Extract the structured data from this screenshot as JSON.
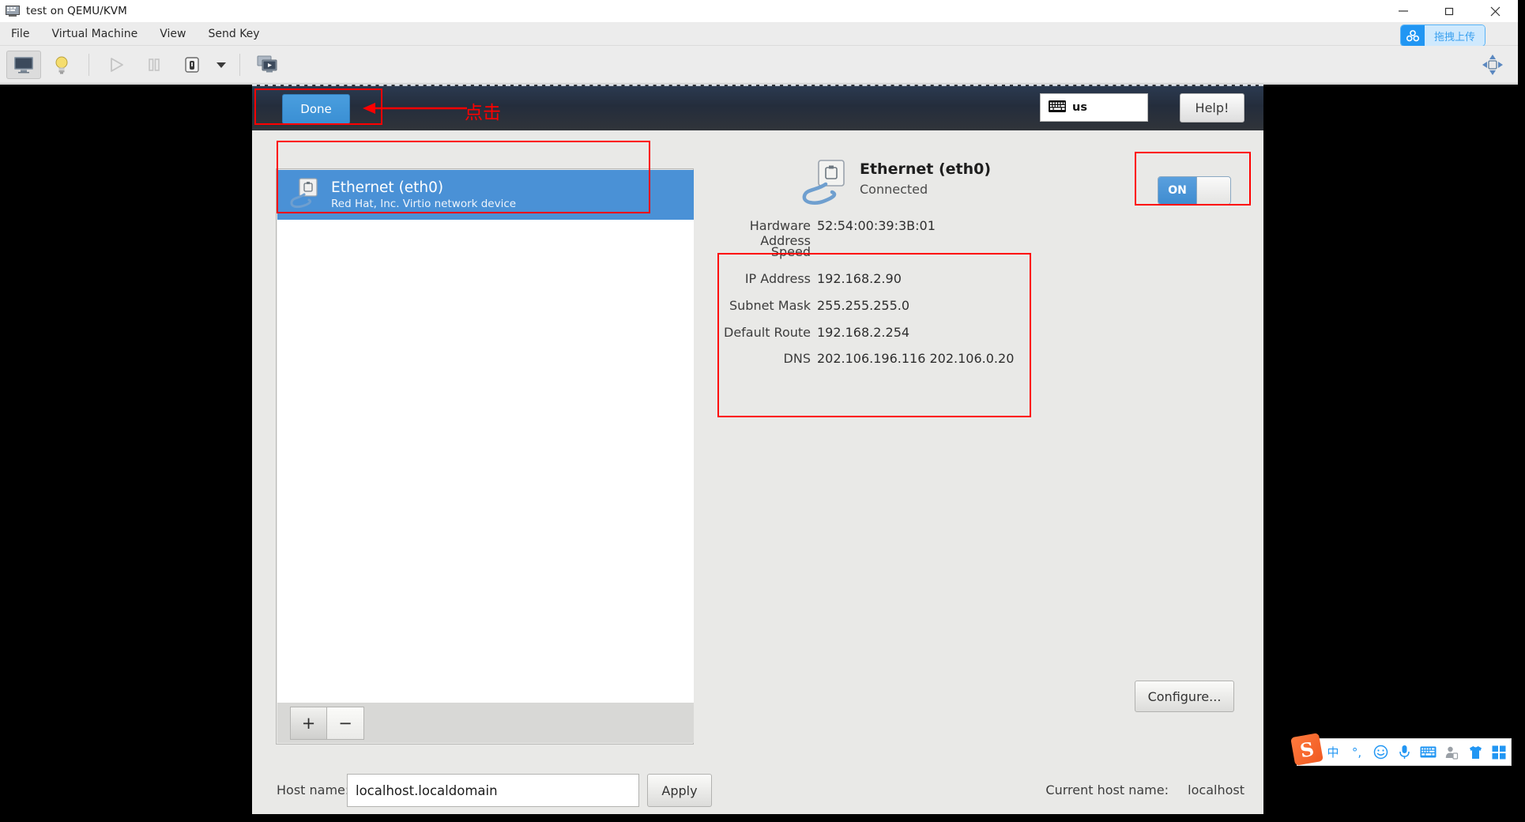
{
  "window": {
    "title": "test on QEMU/KVM",
    "icon": "computer-icon",
    "controls": {
      "minimize": "minimize-icon",
      "maximize": "maximize-icon",
      "close": "close-icon"
    }
  },
  "menubar": {
    "items": [
      {
        "label": "File",
        "name": "menu-file"
      },
      {
        "label": "Virtual Machine",
        "name": "menu-virtual-machine"
      },
      {
        "label": "View",
        "name": "menu-view"
      },
      {
        "label": "Send Key",
        "name": "menu-send-key"
      }
    ],
    "upload_badge": {
      "label": "拖拽上传",
      "icon": "cloud-upload-icon"
    }
  },
  "toolbar": {
    "buttons": [
      {
        "name": "show-console-button",
        "icon": "monitor-icon",
        "active": true
      },
      {
        "name": "show-details-button",
        "icon": "lightbulb-icon",
        "active": false
      },
      {
        "name": "run-button",
        "icon": "play-icon",
        "active": false
      },
      {
        "name": "pause-button",
        "icon": "pause-icon",
        "active": false
      },
      {
        "name": "shutdown-button",
        "icon": "power-icon",
        "active": false
      },
      {
        "name": "shutdown-menu-button",
        "icon": "chevron-down-icon",
        "active": false
      },
      {
        "name": "snapshots-button",
        "icon": "snapshots-icon",
        "active": false
      }
    ],
    "fullscreen": {
      "name": "resize-guest-button",
      "icon": "move-arrows-icon"
    }
  },
  "installer": {
    "header": {
      "done_label": "Done",
      "keyboard_layout": "us",
      "keyboard_icon": "keyboard-icon",
      "help_label": "Help!"
    },
    "device_list": {
      "items": [
        {
          "name": "Ethernet (eth0)",
          "description": "Red Hat, Inc. Virtio network device",
          "icon": "ethernet-icon",
          "selected": true
        }
      ],
      "add_label": "+",
      "remove_label": "−"
    },
    "detail": {
      "icon": "ethernet-icon",
      "title": "Ethernet (eth0)",
      "status": "Connected",
      "toggle": {
        "label": "ON",
        "state": "on"
      },
      "fields": [
        {
          "key": "Hardware Address",
          "value": "52:54:00:39:3B:01"
        },
        {
          "key": "Speed",
          "value": ""
        },
        {
          "key": "IP Address",
          "value": "192.168.2.90"
        },
        {
          "key": "Subnet Mask",
          "value": "255.255.255.0"
        },
        {
          "key": "Default Route",
          "value": "192.168.2.254"
        },
        {
          "key": "DNS",
          "value": "202.106.196.116 202.106.0.20"
        }
      ],
      "configure_label": "Configure..."
    },
    "hostbar": {
      "host_name_label": "Host name:",
      "host_name_value": "localhost.localdomain",
      "host_name_placeholder": "localhost.localdomain",
      "apply_label": "Apply",
      "current_host_name_label": "Current host name:",
      "current_host_name_value": "localhost"
    }
  },
  "annotations": {
    "click_text": "点击",
    "color": "#ff0000",
    "boxes": [
      {
        "name": "annotation-box-done"
      },
      {
        "name": "annotation-box-device"
      },
      {
        "name": "annotation-box-toggle"
      },
      {
        "name": "annotation-box-ipinfo"
      }
    ]
  },
  "ime": {
    "logo": "S",
    "items": [
      {
        "label": "中",
        "name": "ime-chinese-mode"
      },
      {
        "label": "°,",
        "name": "ime-punctuation-mode"
      },
      {
        "label": "☺",
        "name": "ime-emoji"
      },
      {
        "label": "Ἲ4",
        "name": "ime-voice-input"
      },
      {
        "label": "⌨",
        "name": "ime-soft-keyboard"
      },
      {
        "label": "὆4",
        "name": "ime-user"
      },
      {
        "label": "ὅ5",
        "name": "ime-skin"
      },
      {
        "label": "⊞",
        "name": "ime-toolbox"
      }
    ]
  }
}
